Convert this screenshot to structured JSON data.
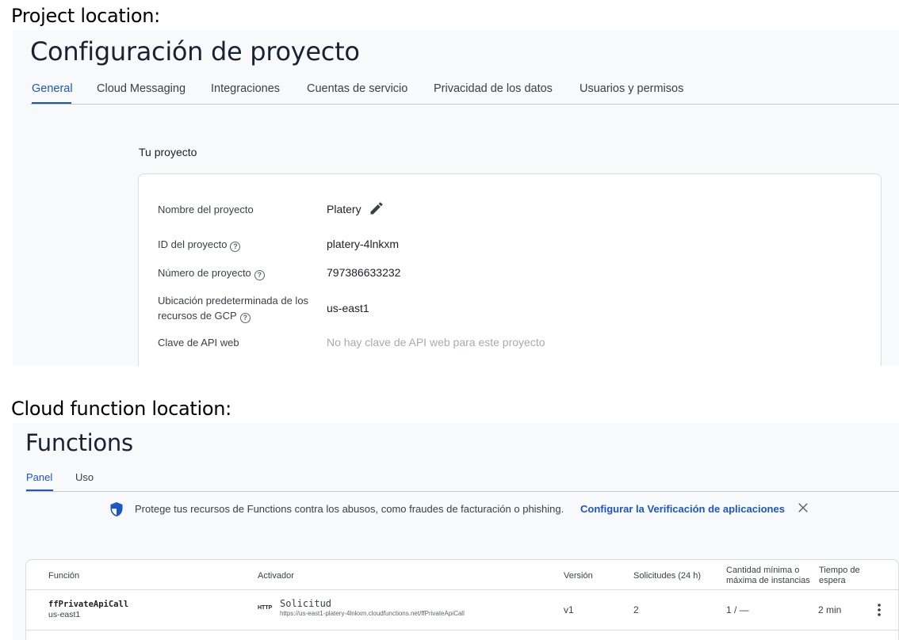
{
  "captions": {
    "project": "Project location:",
    "functions": "Cloud function location:"
  },
  "project_settings": {
    "title": "Configuración de proyecto",
    "tabs": [
      {
        "label": "General",
        "active": true
      },
      {
        "label": "Cloud Messaging"
      },
      {
        "label": "Integraciones"
      },
      {
        "label": "Cuentas de servicio"
      },
      {
        "label": "Privacidad de los datos"
      },
      {
        "label": "Usuarios y permisos"
      }
    ],
    "section_title": "Tu proyecto",
    "fields": [
      {
        "label": "Nombre del proyecto",
        "value": "Platery",
        "icon": "edit-icon"
      },
      {
        "label": "ID del proyecto",
        "value": "platery-4lnkxm",
        "help": true
      },
      {
        "label": "Número de proyecto",
        "value": "797386633232",
        "help": true
      },
      {
        "label_line1": "Ubicación predeterminada de los",
        "label_line2": "recursos de GCP",
        "value": "us-east1",
        "help": true
      },
      {
        "label": "Clave de API web",
        "value": "No hay clave de API web para este proyecto",
        "placeholder": true
      }
    ],
    "accent_color": "#1a56c4"
  },
  "functions": {
    "title": "Functions",
    "tabs": [
      {
        "label": "Panel",
        "active": true
      },
      {
        "label": "Uso"
      }
    ],
    "banner": {
      "icon": "shield-icon",
      "text": "Protege tus recursos de Functions contra los abusos, como fraudes de facturación o phishing.",
      "link": "Configurar la Verificación de aplicaciones",
      "close_icon": "close-icon"
    },
    "table": {
      "headers": {
        "function": "Función",
        "trigger": "Activador",
        "version": "Versión",
        "requests": "Solicitudes (24 h)",
        "instances_line1": "Cantidad mínima o",
        "instances_line2": "máxima de instancias",
        "timeout_line1": "Tiempo de",
        "timeout_line2": "espera"
      },
      "rows": [
        {
          "name": "ffPrivateApiCall",
          "region": "us-east1",
          "trigger_type": "HTTP",
          "trigger": "Solicitud",
          "url": "https://us-east1-platery-4lnkxm.cloudfunctions.net/ffPrivateApiCall",
          "version": "v1",
          "requests": "2",
          "instances": "1 / —",
          "timeout": "2 min"
        }
      ]
    }
  }
}
